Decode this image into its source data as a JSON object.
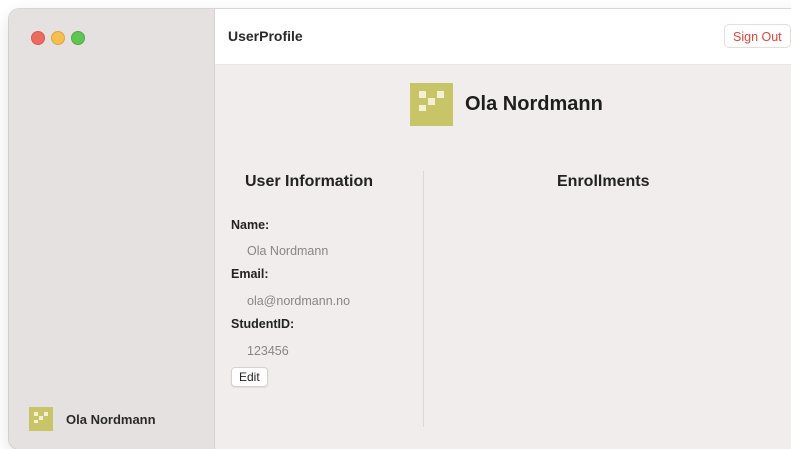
{
  "window": {
    "title": "UserProfile",
    "sign_out_label": "Sign Out"
  },
  "sidebar": {
    "user_name": "Ola Nordmann"
  },
  "profile": {
    "name": "Ola Nordmann"
  },
  "user_information": {
    "title": "User Information",
    "fields": [
      {
        "label": "Name:",
        "value": "Ola Nordmann"
      },
      {
        "label": "Email:",
        "value": "ola@nordmann.no"
      },
      {
        "label": "StudentID:",
        "value": "123456"
      }
    ],
    "edit_label": "Edit"
  },
  "enrollments": {
    "title": "Enrollments"
  },
  "colors": {
    "avatar": "#c8c468",
    "sign_out": "#e0463a",
    "sidebar_bg": "#e6e1e1",
    "content_bg": "#f2eded"
  }
}
